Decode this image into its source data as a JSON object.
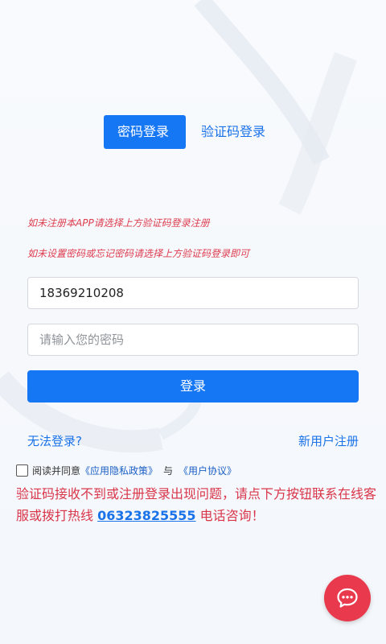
{
  "tabs": [
    {
      "label": "密码登录",
      "active": true
    },
    {
      "label": "验证码登录",
      "active": false
    }
  ],
  "notices": [
    "如未注册本APP请选择上方验证码登录注册",
    "如未设置密码或忘记密码请选择上方验证码登录即可"
  ],
  "phone": {
    "value": "18369210208"
  },
  "password": {
    "value": "",
    "placeholder": "请输入您的密码"
  },
  "login_button": "登录",
  "cannot_login": "无法登录?",
  "register": "新用户注册",
  "agreement": {
    "checked": false,
    "prefix": "阅读并同意",
    "privacy": "《应用隐私政策》",
    "and": "与",
    "terms": "《用户协议》"
  },
  "help": {
    "before": "验证码接收不到或注册登录出现问题，请点下方按钮联系在线客服或拨打热线 ",
    "hotline": "06323825555",
    "after": " 电话咨询！"
  },
  "chat_button_icon": "chat-bubble-icon",
  "colors": {
    "primary": "#1677f5",
    "link": "#1a73e8",
    "notice": "#dd3c4e",
    "fab": "#e8394d"
  }
}
